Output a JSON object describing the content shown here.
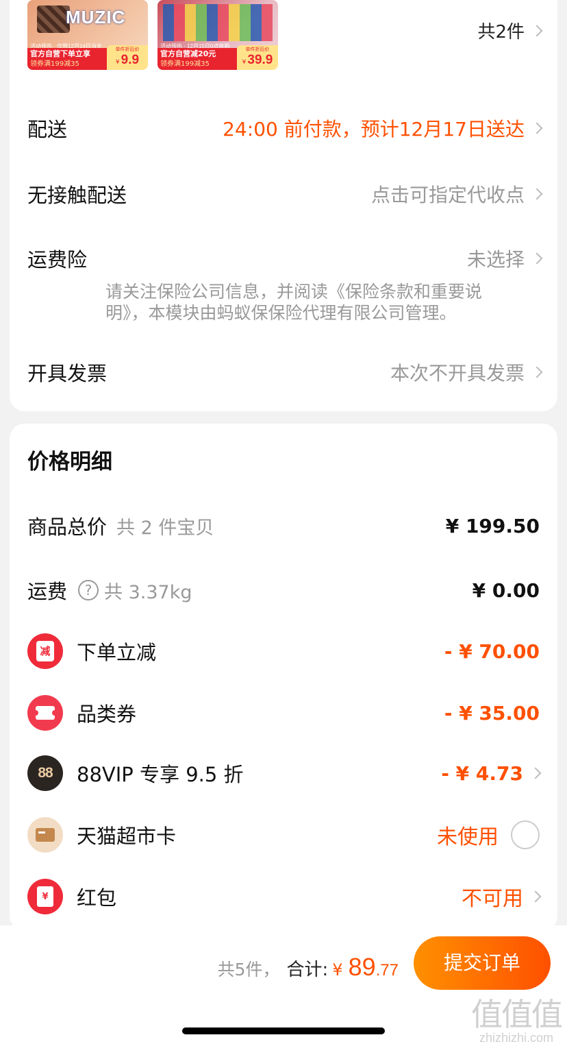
{
  "order": {
    "products": [
      {
        "brand": "MUZIC",
        "tagline": "活动预热 · 仅限12月14日当天",
        "ribbon": "官方自营下单立享",
        "ribbon_sub": "领券满199减35",
        "price_label": "单件折后价",
        "currency": "¥",
        "price": "9.9"
      },
      {
        "brand": "",
        "tagline": "活动预热 · 12月15日0点抢购",
        "ribbon": "官方自营减20元",
        "ribbon_sub": "领券满199减35",
        "price_label": "单件折后价",
        "currency": "¥",
        "price": "39.9"
      }
    ],
    "item_count": "共2件",
    "delivery": {
      "label": "配送",
      "value": "24:00 前付款，预计12月17日送达"
    },
    "contactless": {
      "label": "无接触配送",
      "value": "点击可指定代收点"
    },
    "freight_insurance": {
      "label": "运费险",
      "value": "未选择",
      "desc": "请关注保险公司信息，并阅读《保险条款和重要说明》，本模块由蚂蚁保保险代理有限公司管理。"
    },
    "invoice": {
      "label": "开具发票",
      "value": "本次不开具发票"
    }
  },
  "price_detail": {
    "title": "价格明细",
    "goods_total": {
      "label": "商品总价",
      "sub": "共 2 件宝贝",
      "value": "¥ 199.50"
    },
    "shipping": {
      "label": "运费",
      "sub": "共 3.37kg",
      "value": "¥ 0.00"
    },
    "instant_discount": {
      "icon_text": "减",
      "label": "下单立减",
      "value": "- ¥ 70.00"
    },
    "category_coupon": {
      "label": "品类券",
      "value": "- ¥ 35.00"
    },
    "vip": {
      "icon_text": "88",
      "label": "88VIP 专享 9.5 折",
      "value": "- ¥ 4.73"
    },
    "supermarket_card": {
      "label": "天猫超市卡",
      "value": "未使用"
    },
    "red_packet": {
      "icon_text": "¥",
      "label": "红包",
      "value": "不可用"
    }
  },
  "footer": {
    "count": "共5件，",
    "total_label": "合计:",
    "currency": "¥",
    "total_int": "89",
    "total_dec": ".77",
    "submit": "提交订单"
  },
  "watermark": {
    "big": "值值值",
    "small": "zhizhizhi.com"
  },
  "colors": {
    "accent": "#ff5000",
    "button_start": "#ff9000",
    "button_end": "#ff5000",
    "muted": "#999999"
  }
}
